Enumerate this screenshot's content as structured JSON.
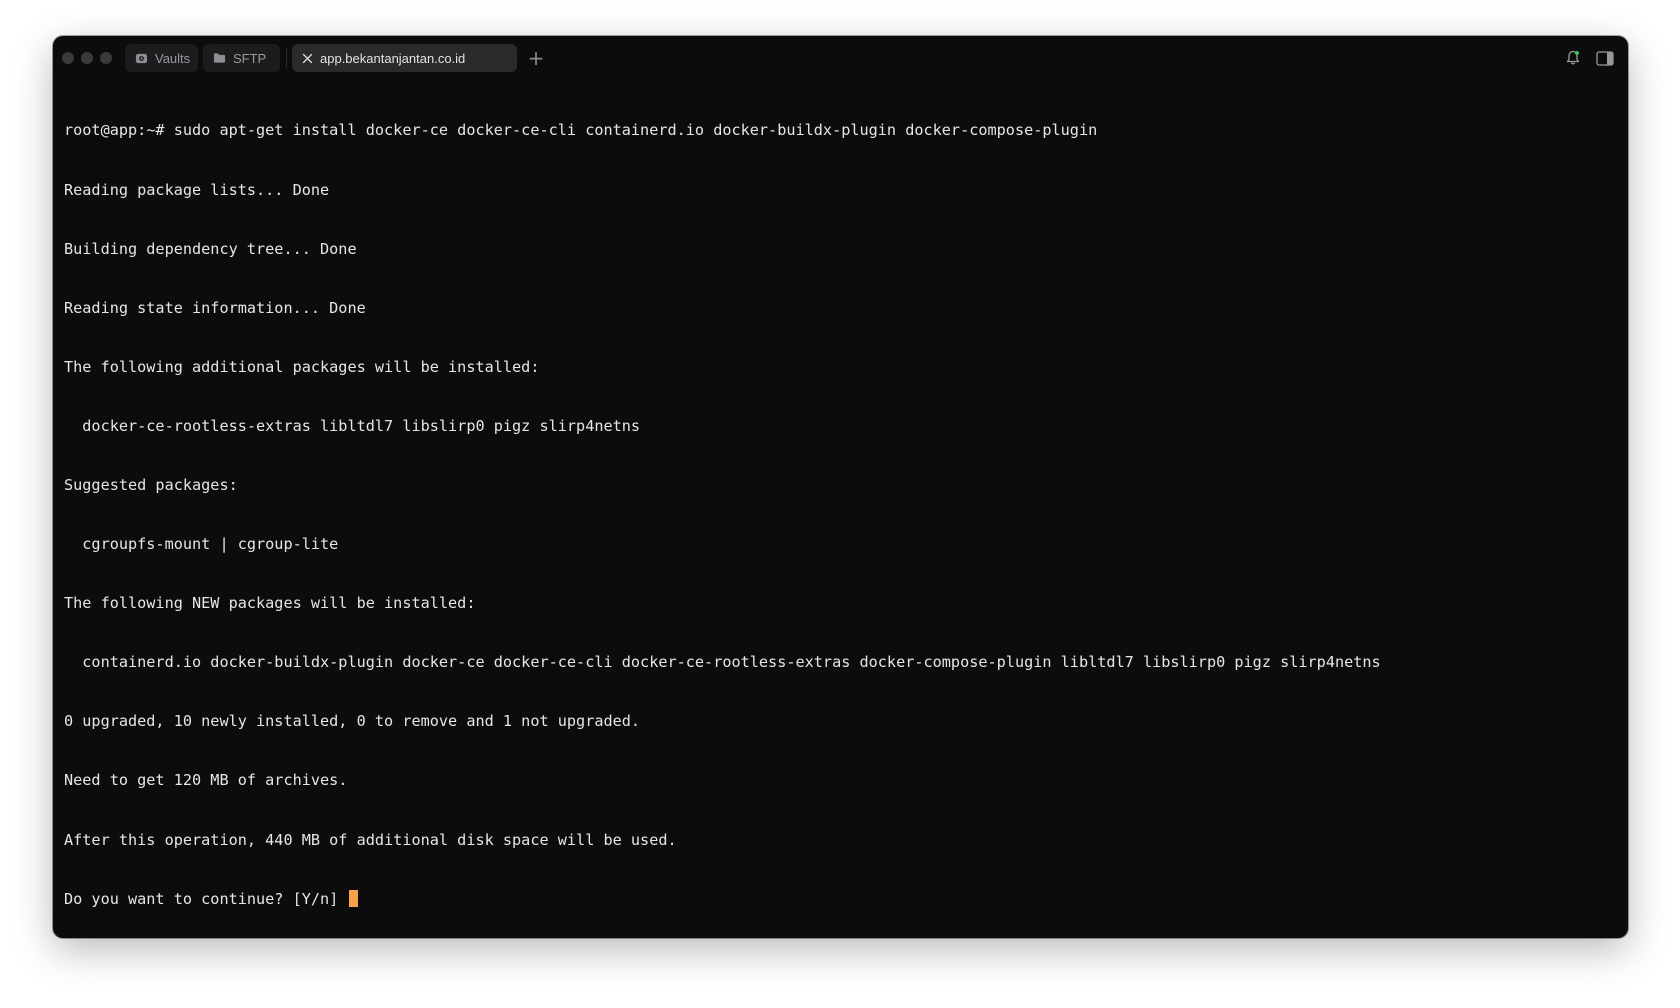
{
  "window": {
    "tabs": [
      {
        "label": "Vaults",
        "icon": "vault-icon"
      },
      {
        "label": "SFTP",
        "icon": "folder-icon"
      },
      {
        "label": "app.bekantanjantan.co.id",
        "icon": "close-icon",
        "active": true
      }
    ],
    "new_tab_label": "+",
    "right_icons": [
      "bell-icon",
      "sidebar-toggle-icon"
    ]
  },
  "terminal": {
    "lines": [
      "root@app:~# sudo apt-get install docker-ce docker-ce-cli containerd.io docker-buildx-plugin docker-compose-plugin",
      "Reading package lists... Done",
      "Building dependency tree... Done",
      "Reading state information... Done",
      "The following additional packages will be installed:",
      "  docker-ce-rootless-extras libltdl7 libslirp0 pigz slirp4netns",
      "Suggested packages:",
      "  cgroupfs-mount | cgroup-lite",
      "The following NEW packages will be installed:",
      "  containerd.io docker-buildx-plugin docker-ce docker-ce-cli docker-ce-rootless-extras docker-compose-plugin libltdl7 libslirp0 pigz slirp4netns",
      "0 upgraded, 10 newly installed, 0 to remove and 1 not upgraded.",
      "Need to get 120 MB of archives.",
      "After this operation, 440 MB of additional disk space will be used.",
      "Do you want to continue? [Y/n] "
    ],
    "cursor_color": "#f5a24b"
  }
}
